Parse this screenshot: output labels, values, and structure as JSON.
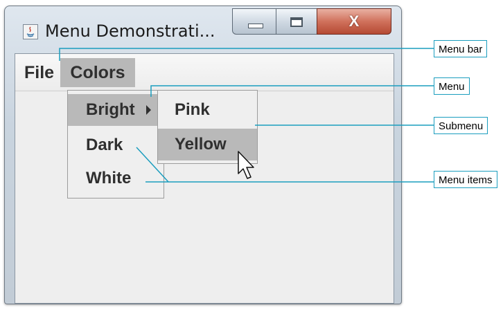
{
  "window": {
    "title": "Menu Demonstrati...",
    "app_icon": "java-icon",
    "controls": {
      "minimize": "minimize-icon",
      "maximize": "maximize-icon",
      "close": "X"
    }
  },
  "menubar": {
    "items": [
      {
        "label": "File"
      },
      {
        "label": "Colors",
        "state": "open"
      }
    ]
  },
  "colors_menu": {
    "items": [
      {
        "label": "Bright",
        "has_submenu": true,
        "state": "highlighted"
      },
      {
        "label": "Dark"
      },
      {
        "label": "White"
      }
    ]
  },
  "bright_submenu": {
    "items": [
      {
        "label": "Pink"
      },
      {
        "label": "Yellow",
        "state": "highlighted"
      }
    ]
  },
  "callouts": {
    "menu_bar": "Menu bar",
    "menu": "Menu",
    "submenu": "Submenu",
    "menu_items": "Menu items"
  },
  "colors": {
    "callout_line": "#1a9dbe",
    "highlight": "#b9b9b9",
    "close_button": "#c95d45"
  }
}
